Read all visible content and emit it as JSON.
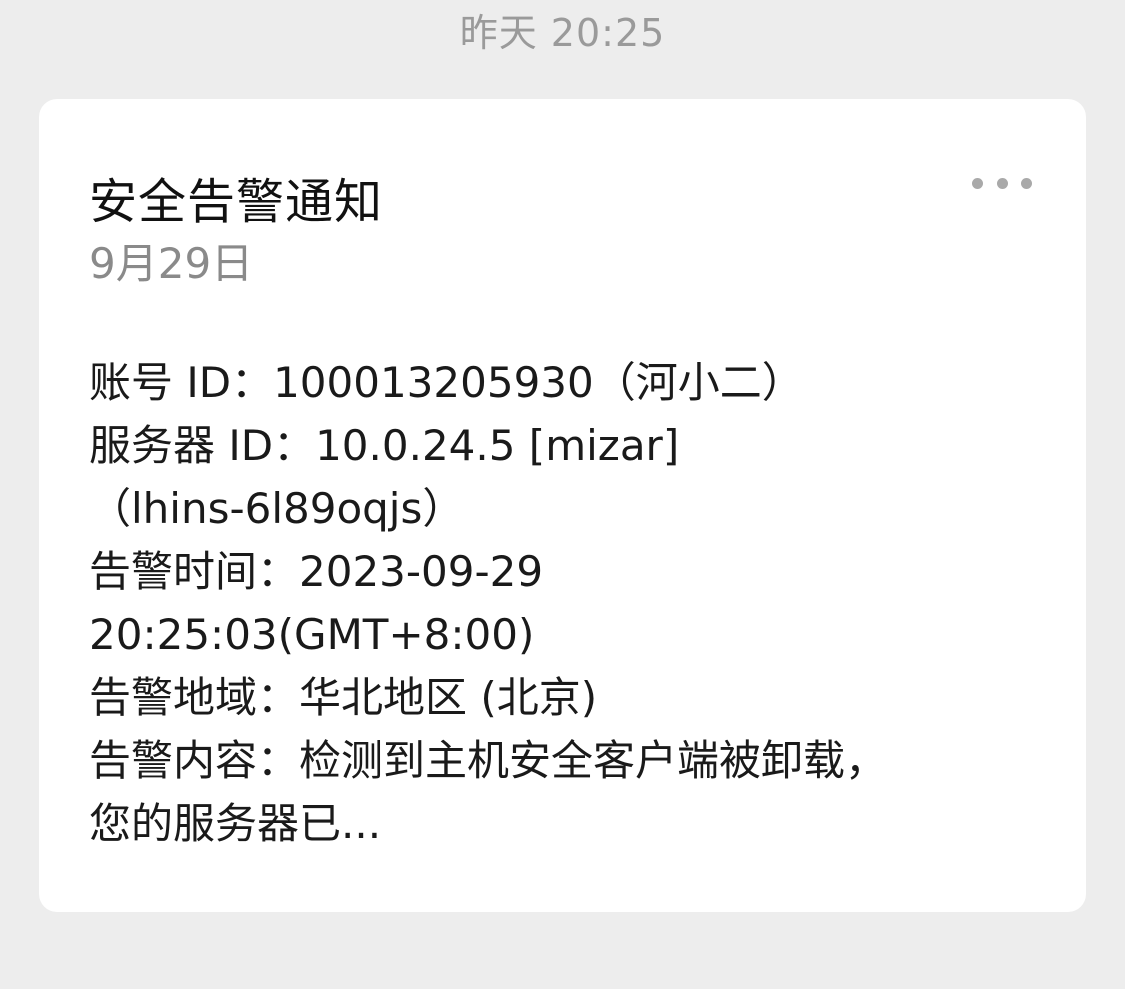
{
  "chat": {
    "timestamp": "昨天 20:25"
  },
  "card": {
    "title": "安全告警通知",
    "date": "9月29日",
    "more_icon": "more-horizontal-icon",
    "lines": [
      "账号 ID：100013205930（河小二）",
      "服务器 ID：10.0.24.5 [mizar]",
      "（lhins-6l89oqjs）",
      "告警时间：2023-09-29",
      "20:25:03(GMT+8:00)",
      "告警地域：华北地区 (北京)",
      "告警内容：检测到主机安全客户端被卸载，",
      "您的服务器已..."
    ]
  },
  "colors": {
    "background": "#ededed",
    "card": "#ffffff",
    "muted_text": "#9a9a9a",
    "primary_text": "#111111"
  }
}
